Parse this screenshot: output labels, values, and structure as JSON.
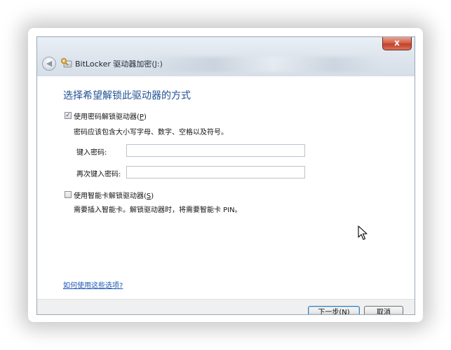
{
  "window": {
    "title": "BitLocker 驱动器加密(J:)",
    "close_label": "x"
  },
  "page": {
    "heading": "选择希望解锁此驱动器的方式"
  },
  "password_option": {
    "checked": true,
    "check_glyph": "✓",
    "label_pre": "使用密码解锁驱动器(",
    "label_key": "P",
    "label_post": ")",
    "description": "密码应该包含大小写字母、数字、空格以及符号。",
    "enter_label": "键入密码:",
    "enter_value": "",
    "reenter_label": "再次键入密码:",
    "reenter_value": ""
  },
  "smartcard_option": {
    "checked": false,
    "label_pre": "使用智能卡解锁驱动器(",
    "label_key": "S",
    "label_post": ")",
    "description": "需要插入智能卡。解锁驱动器时，将需要智能卡 PIN。"
  },
  "help_link": "如何使用这些选项?",
  "buttons": {
    "next": "下一步(N)",
    "cancel": "取消"
  }
}
